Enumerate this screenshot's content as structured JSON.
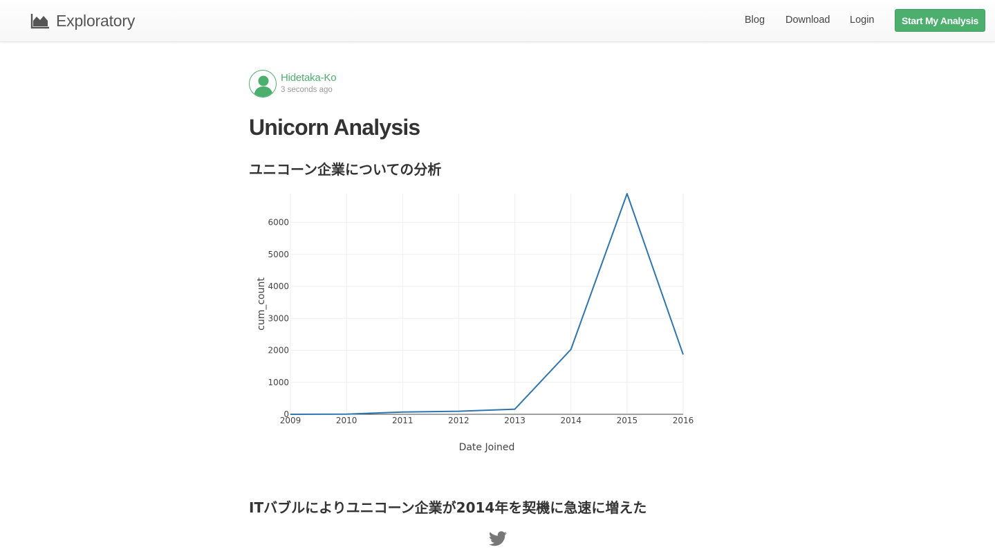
{
  "brand": {
    "name": "Exploratory",
    "icon": "area-chart-icon"
  },
  "nav": {
    "blog": "Blog",
    "download": "Download",
    "login": "Login",
    "cta": "Start My Analysis"
  },
  "colors": {
    "accent": "#4caf6e",
    "line": "#2e75b0",
    "text": "#333333"
  },
  "author": {
    "name": "Hidetaka-Ko",
    "time": "3 seconds ago",
    "avatar_icon": "person-silhouette-icon"
  },
  "post": {
    "title": "Unicorn Analysis",
    "subtitle": "ユニコーン企業についての分析",
    "conclusion": "ITバブルによりユニコーン企業が2014年を契機に急速に増えた"
  },
  "share": {
    "icon": "twitter-icon"
  },
  "chart_data": {
    "type": "line",
    "x": [
      2009,
      2010,
      2011,
      2012,
      2013,
      2014,
      2015,
      2016
    ],
    "series": [
      {
        "values": [
          0,
          5,
          70,
          95,
          160,
          2030,
          6900,
          1870
        ]
      }
    ],
    "xlabel": "Date Joined",
    "ylabel": "cum_count",
    "xlim": [
      2009,
      2016
    ],
    "ylim": [
      0,
      6900
    ],
    "xticks": [
      "2009",
      "2010",
      "2011",
      "2012",
      "2013",
      "2014",
      "2015",
      "2016"
    ],
    "yticks": [
      "0",
      "1000",
      "2000",
      "3000",
      "4000",
      "5000",
      "6000"
    ],
    "grid": true,
    "legend": "none"
  }
}
